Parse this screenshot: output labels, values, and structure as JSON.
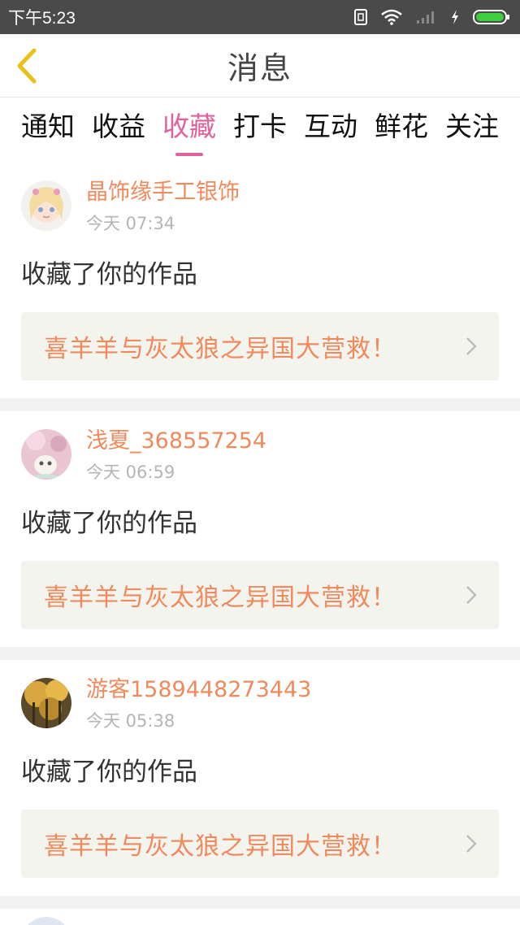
{
  "status_bar": {
    "time": "下午5:23"
  },
  "header": {
    "title": "消息",
    "back_icon": "back-chevron-icon"
  },
  "tabs": [
    {
      "label": "通知",
      "active": false
    },
    {
      "label": "收益",
      "active": false
    },
    {
      "label": "收藏",
      "active": true
    },
    {
      "label": "打卡",
      "active": false
    },
    {
      "label": "互动",
      "active": false
    },
    {
      "label": "鲜花",
      "active": false
    },
    {
      "label": "关注",
      "active": false
    }
  ],
  "messages": [
    {
      "username": "晶饰缘手工银饰",
      "time": "今天 07:34",
      "action": "收藏了你的作品",
      "work_title": "喜羊羊与灰太狼之异国大营救！"
    },
    {
      "username": "浅夏_368557254",
      "time": "今天 06:59",
      "action": "收藏了你的作品",
      "work_title": "喜羊羊与灰太狼之异国大营救！"
    },
    {
      "username": "游客1589448273443",
      "time": "今天 05:38",
      "action": "收藏了你的作品",
      "work_title": "喜羊羊与灰太狼之异国大营救！"
    }
  ],
  "colors": {
    "accent_pink": "#e0619c",
    "username_orange": "#f08a5d",
    "status_bar": "#4a4a4a",
    "battery_green": "#3ecf3e"
  }
}
